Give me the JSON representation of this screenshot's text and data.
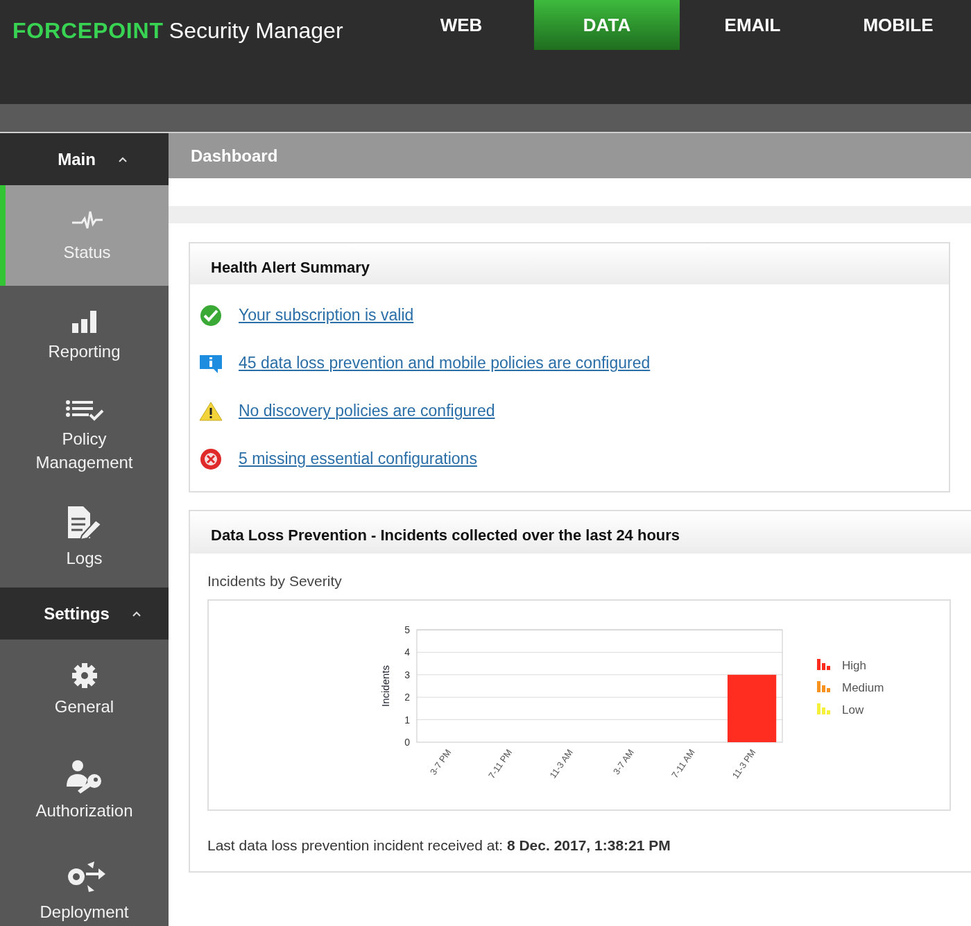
{
  "header": {
    "brand": "FORCEPOINT",
    "product": "Security Manager",
    "tabs": [
      {
        "label": "WEB",
        "selected": false
      },
      {
        "label": "DATA",
        "selected": true
      },
      {
        "label": "EMAIL",
        "selected": false
      },
      {
        "label": "MOBILE",
        "selected": false
      }
    ]
  },
  "sidebar": {
    "sections": [
      {
        "title": "Main",
        "expanded": true,
        "items": [
          {
            "label": "Status",
            "selected": true
          },
          {
            "label": "Reporting",
            "selected": false
          },
          {
            "label": "Policy Management",
            "selected": false
          },
          {
            "label": "Logs",
            "selected": false
          }
        ]
      },
      {
        "title": "Settings",
        "expanded": true,
        "items": [
          {
            "label": "General",
            "selected": false
          },
          {
            "label": "Authorization",
            "selected": false
          },
          {
            "label": "Deployment",
            "selected": false
          }
        ]
      }
    ]
  },
  "page_title": "Dashboard",
  "health": {
    "title": "Health Alert Summary",
    "alerts": [
      {
        "kind": "ok",
        "text": "Your subscription is valid"
      },
      {
        "kind": "info",
        "text": "45 data loss prevention and mobile policies are configured"
      },
      {
        "kind": "warning",
        "text": "No discovery policies are configured"
      },
      {
        "kind": "error",
        "text": "5 missing essential configurations"
      }
    ]
  },
  "incidents": {
    "title": "Data Loss Prevention - Incidents collected over the last 24 hours",
    "chart_title": "Incidents by Severity",
    "chart_data": {
      "type": "bar",
      "stacked": true,
      "grid": true,
      "ylabel": "Incidents",
      "categories": [
        "3-7 PM",
        "7-11 PM",
        "11-3 AM",
        "3-7 AM",
        "7-11 AM",
        "11-3 PM"
      ],
      "ylim": [
        0,
        5
      ],
      "yticks": [
        0,
        1,
        2,
        3,
        4,
        5
      ],
      "series": [
        {
          "name": "High",
          "color": "#ff2d1f",
          "values": [
            0,
            0,
            0,
            0,
            0,
            3
          ]
        },
        {
          "name": "Medium",
          "color": "#f7931e",
          "values": [
            0,
            0,
            0,
            0,
            0,
            0
          ]
        },
        {
          "name": "Low",
          "color": "#f5f03a",
          "values": [
            0,
            0,
            0,
            0,
            0,
            0
          ]
        }
      ]
    },
    "last_incident": "Last data loss prevention incident received at: **8 Dec. 2017, 1:38:21 PM**"
  }
}
